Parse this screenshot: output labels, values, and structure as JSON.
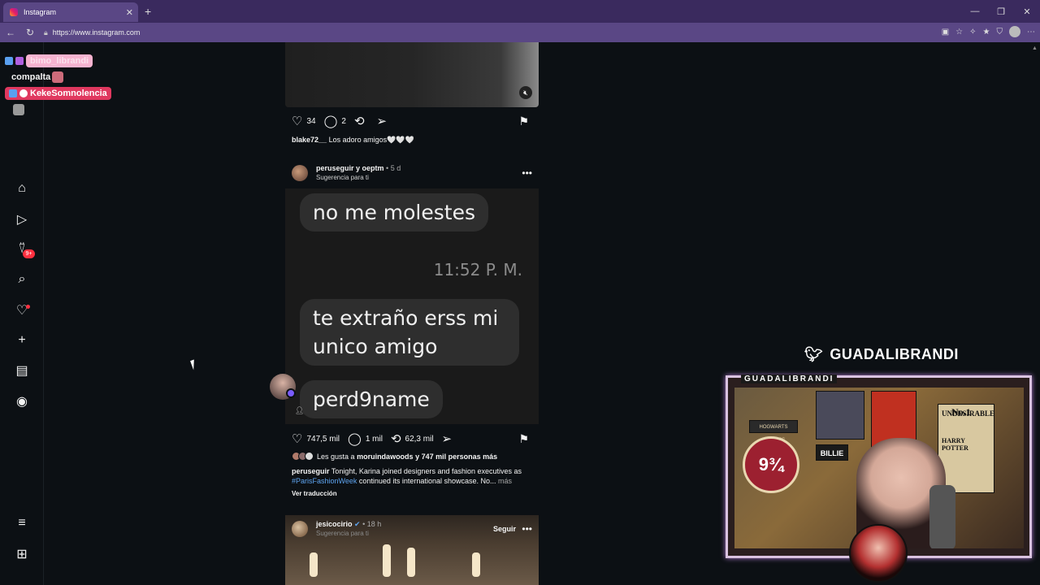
{
  "browser": {
    "tab_title": "Instagram",
    "tab_close": "✕",
    "new_tab": "+",
    "url": "https://www.instagram.com",
    "win_min": "—",
    "win_max": "❐",
    "win_close": "✕"
  },
  "chat_overlay": {
    "lines": [
      {
        "user": "bimo_librandi"
      },
      {
        "user": "compalta"
      },
      {
        "user": "KekeSomnolencia"
      }
    ]
  },
  "sidebar": {
    "messages_badge": "9+"
  },
  "post1": {
    "likes": "34",
    "comments": "2",
    "caption_user": "blake72__",
    "caption_text": "Los adoro amigos🤍🤍🤍"
  },
  "post2": {
    "header_users": "peruseguir y oeptm",
    "time": "• 5 d",
    "subtitle": "Sugerencia para ti",
    "bubble1": "no me molestes",
    "timestamp": "11:52 P. M.",
    "bubble2": "te extraño erss mi unico amigo",
    "bubble3": "perd9name",
    "likes": "747,5 mil",
    "comments": "1 mil",
    "reposts": "62,3 mil",
    "liked_by_prefix": "Les gusta a",
    "liked_by_user": "moruindawoods",
    "liked_by_suffix": "y 747 mil personas más",
    "caption_user": "peruseguir",
    "caption_text_1": "Tonight, Karina joined designers and fashion executives as",
    "caption_hashtag": "#ParisFashionWeek",
    "caption_text_2": "continued its international showcase. No...",
    "more_label": "más",
    "translate_label": "Ver traducción"
  },
  "post3": {
    "user": "jesicocirio",
    "time": "• 18 h",
    "subtitle": "Sugerencia para ti",
    "follow_label": "Seguir"
  },
  "stream_overlay": {
    "twitter_handle": "GUADALIBRANDI",
    "cam_title": "GUADALIBRANDI",
    "platform_label": "9¾",
    "poster_text_1": "UNDESIRABLE",
    "poster_text_2": "No.1",
    "poster_text_3": "HARRY POTTER",
    "poster_text_4": "BILLIE",
    "poster_text_5": "HOGWARTS EXPRESS"
  },
  "colors": {
    "browser_tabbar": "#3a2a5e",
    "browser_addr": "#5a4785",
    "page_bg": "#0c1014",
    "notification": "#ff3040",
    "hashtag": "#5ea4f0"
  }
}
